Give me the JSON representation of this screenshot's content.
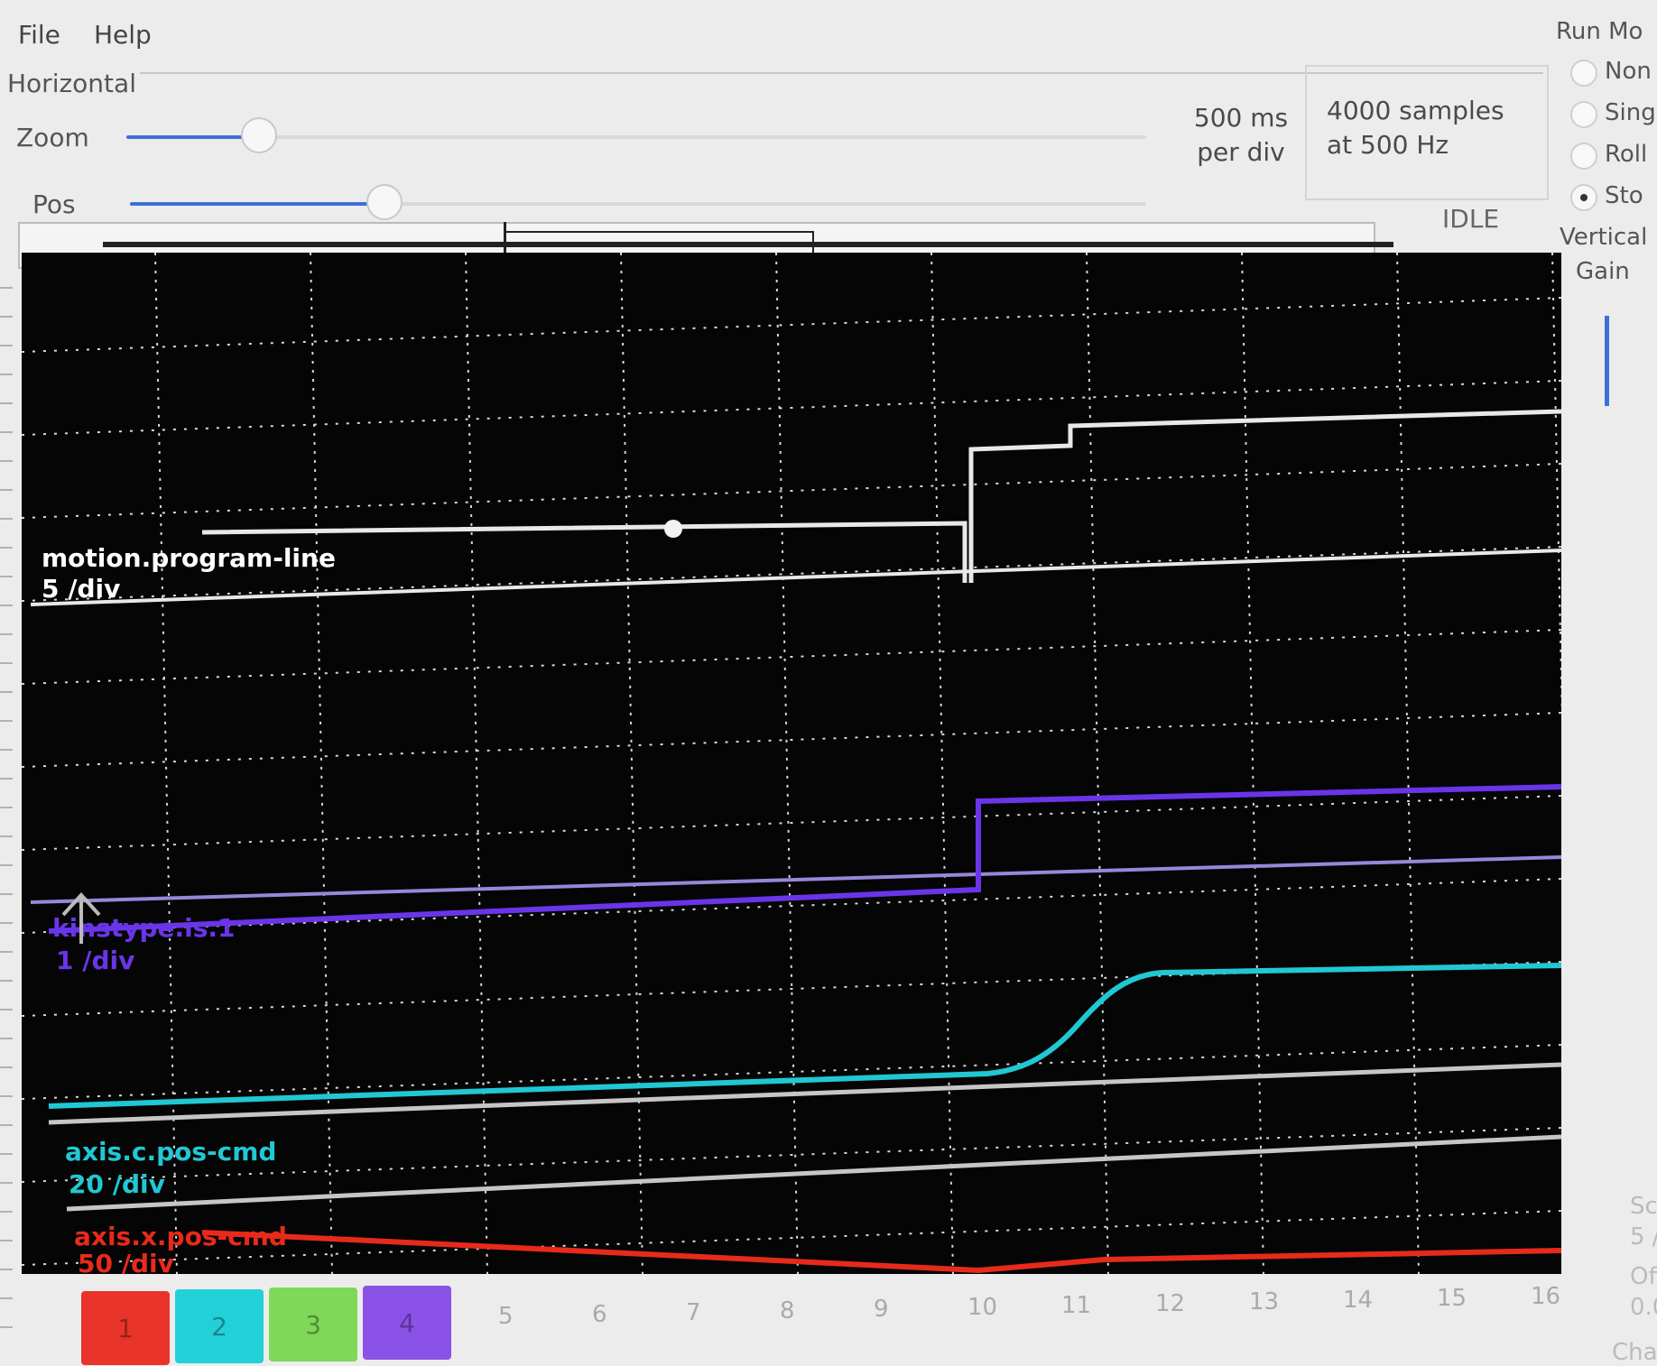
{
  "menu": {
    "items": [
      "File",
      "Help"
    ]
  },
  "horizontal": {
    "frame_label": "Horizontal",
    "zoom_label": "Zoom",
    "zoom_value": 0.13,
    "pos_label": "Pos",
    "pos_value": 0.25,
    "per_div_line1": "500 ms",
    "per_div_line2": "per div",
    "samples_line1": "4000 samples",
    "samples_line2": "at 500 Hz",
    "status": "IDLE"
  },
  "run_mode": {
    "title": "Run Mo",
    "options": [
      {
        "label": "Non",
        "selected": false
      },
      {
        "label": "Sing",
        "selected": false
      },
      {
        "label": "Roll",
        "selected": false
      },
      {
        "label": "Sto",
        "selected": true
      }
    ]
  },
  "vertical": {
    "title": "Vertical",
    "gain_label": "Gain"
  },
  "right_bottom": {
    "sc": "Sc",
    "sc_val": "5 /",
    "off": "Off",
    "off_val": "0.0",
    "cha": "Cha"
  },
  "channels": {
    "buttons": [
      {
        "label": "1",
        "color": "#e8342a"
      },
      {
        "label": "2",
        "color": "#22d0d8"
      },
      {
        "label": "3",
        "color": "#7fd858"
      },
      {
        "label": "4",
        "color": "#8a52e6"
      }
    ],
    "numbers": [
      "5",
      "6",
      "7",
      "8",
      "9",
      "10",
      "11",
      "12",
      "13",
      "14",
      "15",
      "16"
    ]
  },
  "traces": [
    {
      "name": "motion.program-line",
      "scale": "5 /div",
      "color": "#ffffff"
    },
    {
      "name": "kinstype.is.1",
      "scale": "1 /div",
      "color": "#6a35e8"
    },
    {
      "name": "axis.c.pos-cmd",
      "scale": "20 /div",
      "color": "#20c8d4"
    },
    {
      "name": "axis.x.pos-cmd",
      "scale": "50 /div",
      "color": "#e82a1a"
    }
  ]
}
